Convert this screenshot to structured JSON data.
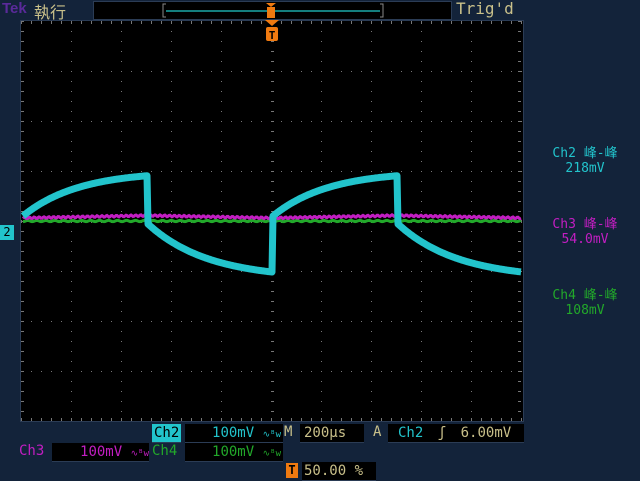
{
  "header": {
    "brand": "Tek",
    "run_state": "執行",
    "trigger_status": "Trig'd"
  },
  "measurements": [
    {
      "label": "Ch2 峰-峰",
      "value": "218mV",
      "color": "#22c4cc"
    },
    {
      "label": "Ch3 峰-峰",
      "value": "54.0mV",
      "color": "#c21ec2"
    },
    {
      "label": "Ch4 峰-峰",
      "value": "108mV",
      "color": "#22a82a"
    }
  ],
  "channels": {
    "ch2": {
      "label": "Ch2",
      "scale": "100mV",
      "bw": "∿ᴮw",
      "color": "#22c4cc"
    },
    "ch3": {
      "label": "Ch3",
      "scale": "100mV",
      "bw": "∿ᴮw",
      "color": "#c21ec2"
    },
    "ch4": {
      "label": "Ch4",
      "scale": "100mV",
      "bw": "∿ᴮw",
      "color": "#22a82a"
    }
  },
  "ch2_marker": "2",
  "timebase": {
    "label": "M",
    "value": "200µs"
  },
  "trigger": {
    "mode": "A",
    "source": "Ch2",
    "slope": "ʃ",
    "level": "6.00mV",
    "marker": "T",
    "position": "50.00 %"
  }
}
